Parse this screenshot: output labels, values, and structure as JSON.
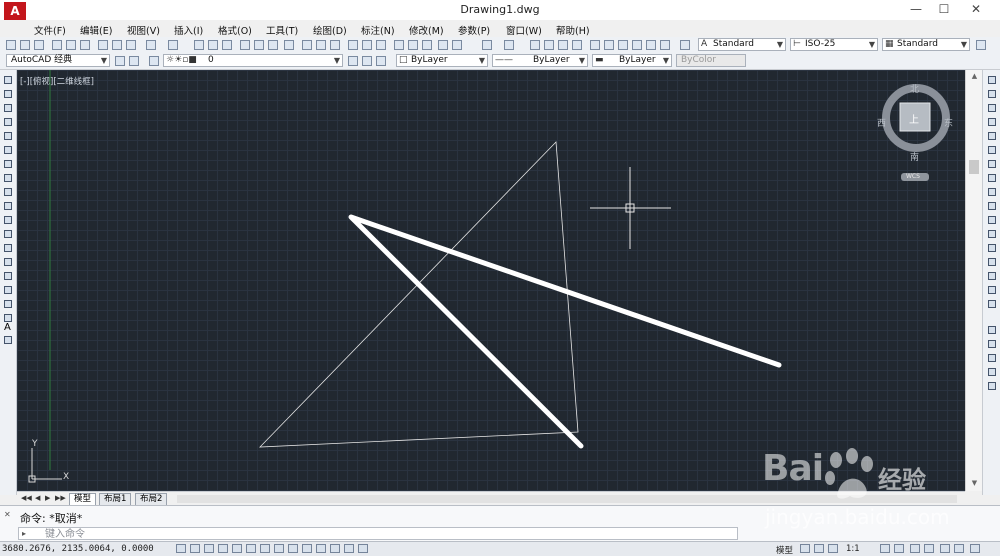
{
  "window": {
    "title": "Drawing1.dwg",
    "logo_letter": "A"
  },
  "menu": [
    "文件(F)",
    "编辑(E)",
    "视图(V)",
    "插入(I)",
    "格式(O)",
    "工具(T)",
    "绘图(D)",
    "标注(N)",
    "修改(M)",
    "参数(P)",
    "窗口(W)",
    "帮助(H)"
  ],
  "styles": {
    "text_style": "Standard",
    "dim_style": "ISO-25",
    "table_style": "Standard"
  },
  "workspace": "AutoCAD 经典",
  "layer": {
    "name": "0"
  },
  "properties": {
    "color": "ByLayer",
    "linetype": "ByLayer",
    "lineweight": "ByLayer",
    "plotstyle": "ByColor"
  },
  "viewport": {
    "label": "[-][俯视][二维线框]"
  },
  "viewcube": {
    "north": "北",
    "south": "南",
    "east": "东",
    "west": "西",
    "top": "上",
    "wcs": "WCS"
  },
  "ucs": {
    "x": "X",
    "y": "Y"
  },
  "tabs": [
    "模型",
    "布局1",
    "布局2"
  ],
  "command": {
    "history": "命令: *取消*",
    "placeholder": "键入命令"
  },
  "status": {
    "coords": "3680.2676, 2135.0064, 0.0000",
    "model": "模型",
    "scale": "1:1"
  },
  "watermark": {
    "logo": "Bai",
    "cn": "经验",
    "url": "jingyan.baidu.com"
  },
  "colors": {
    "canvas": "#212830",
    "grid": "#2a3340",
    "logo": "#c3161c"
  }
}
